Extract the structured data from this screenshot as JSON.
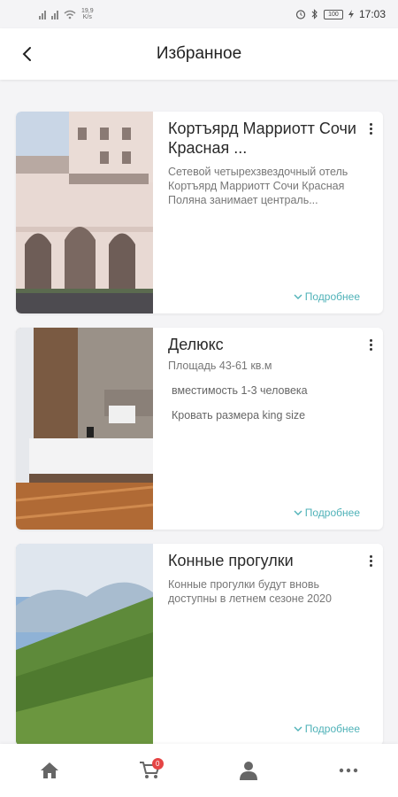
{
  "statusbar": {
    "speed_value": "19,9",
    "speed_unit": "K/s",
    "battery": "100",
    "time": "17:03"
  },
  "header": {
    "title": "Избранное",
    "back_icon": "chevron-left-icon"
  },
  "cards": [
    {
      "title": "Кортъярд Марриотт Сочи Красная ...",
      "description": "Сетевой четырехзвездочный отель Кортъярд Марриотт Сочи Красная Поляна занимает централь...",
      "more": "Подробнее",
      "image": "hotel-facade-photo"
    },
    {
      "title": "Делюкс",
      "subtitle": "Площадь 43-61 кв.м",
      "features": [
        "вместимость 1-3 человека",
        "Кровать размера king size"
      ],
      "more": "Подробнее",
      "image": "hotel-room-photo"
    },
    {
      "title": "Конные прогулки",
      "description": "Конные прогулки будут вновь доступны в летнем сезоне 2020",
      "more": "Подробнее",
      "image": "mountain-meadow-photo"
    }
  ],
  "nav": {
    "items": [
      "home-icon",
      "cart-icon",
      "user-icon",
      "more-icon"
    ],
    "cart_badge": "0"
  },
  "colors": {
    "accent": "#4fb2b8",
    "badge": "#e54545",
    "background": "#f4f4f6"
  }
}
